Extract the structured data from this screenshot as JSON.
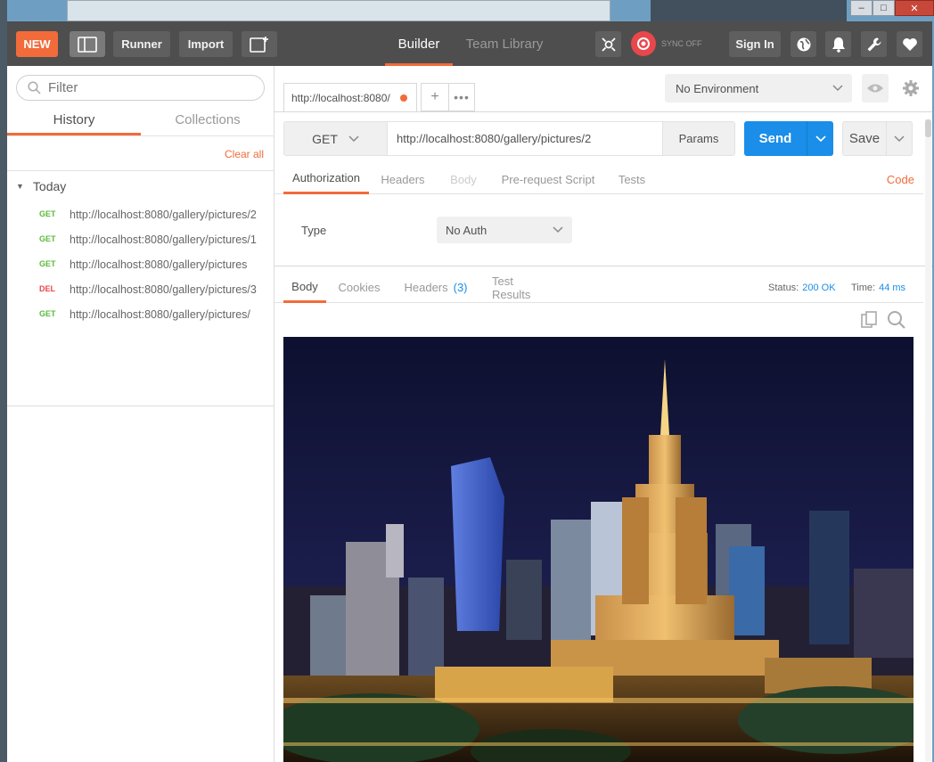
{
  "window": {
    "minimize": "–",
    "maximize": "□",
    "close": "✕"
  },
  "topbar": {
    "new_label": "NEW",
    "runner_label": "Runner",
    "import_label": "Import",
    "builder_label": "Builder",
    "team_library_label": "Team Library",
    "sync_label": "SYNC OFF",
    "signin_label": "Sign In",
    "colors": {
      "accent": "#f26b3a",
      "bar": "#4e4e4e",
      "sync": "#e8474b"
    }
  },
  "sidebar": {
    "filter_placeholder": "Filter",
    "tabs": [
      "History",
      "Collections"
    ],
    "clear_all": "Clear all",
    "group": "Today",
    "history": [
      {
        "method": "GET",
        "url": "http://localhost:8080/gallery/pictures/2"
      },
      {
        "method": "GET",
        "url": "http://localhost:8080/gallery/pictures/1"
      },
      {
        "method": "GET",
        "url": "http://localhost:8080/gallery/pictures"
      },
      {
        "method": "DEL",
        "url": "http://localhost:8080/gallery/pictures/3"
      },
      {
        "method": "GET",
        "url": "http://localhost:8080/gallery/pictures/"
      }
    ]
  },
  "request": {
    "tab_title": "http://localhost:8080/",
    "tab_add": "+",
    "tab_more": "•••",
    "environment": "No Environment",
    "method": "GET",
    "url": "http://localhost:8080/gallery/pictures/2",
    "params_label": "Params",
    "send_label": "Send",
    "save_label": "Save",
    "subtabs": [
      "Authorization",
      "Headers",
      "Body",
      "Pre-request Script",
      "Tests"
    ],
    "code_label": "Code",
    "auth": {
      "type_label": "Type",
      "type_value": "No Auth"
    }
  },
  "response": {
    "tabs": [
      "Body",
      "Cookies",
      "Headers",
      "Test Results"
    ],
    "headers_count": "(3)",
    "status_label": "Status:",
    "status_value": "200 OK",
    "time_label": "Time:",
    "time_value": "44 ms"
  }
}
